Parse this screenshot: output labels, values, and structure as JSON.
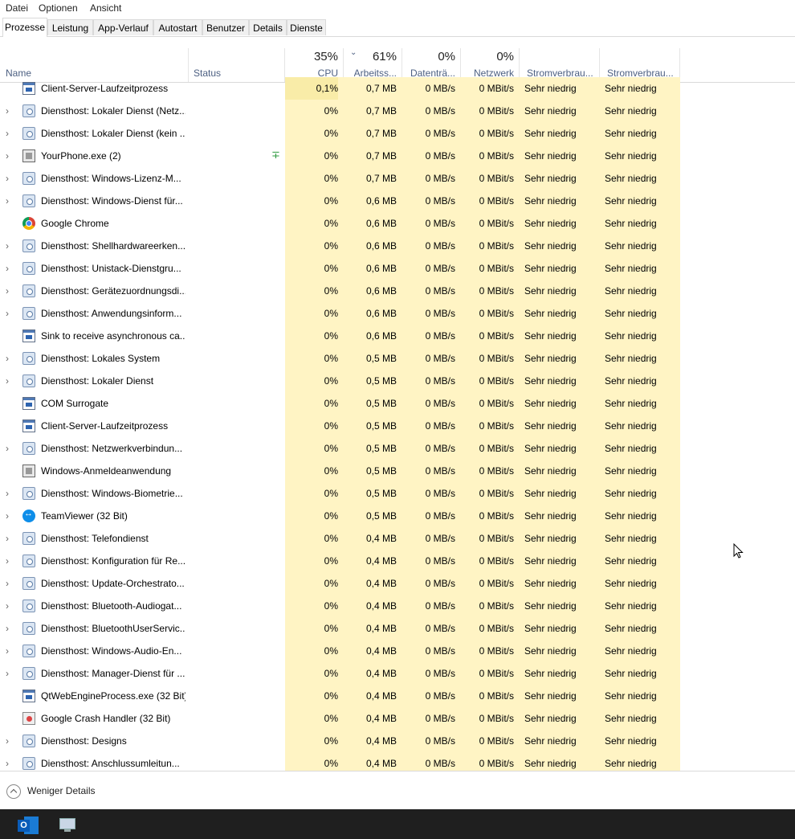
{
  "menu": [
    "Datei",
    "Optionen",
    "Ansicht"
  ],
  "tabs": [
    "Prozesse",
    "Leistung",
    "App-Verlauf",
    "Autostart",
    "Benutzer",
    "Details",
    "Dienste"
  ],
  "active_tab": 0,
  "columns": {
    "name": {
      "label": "Name"
    },
    "status": {
      "label": "Status"
    },
    "cpu": {
      "label": "CPU",
      "pct": "35%"
    },
    "mem": {
      "label": "Arbeitss...",
      "pct": "61%"
    },
    "disk": {
      "label": "Datenträ...",
      "pct": "0%"
    },
    "net": {
      "label": "Netzwerk",
      "pct": "0%"
    },
    "power": {
      "label": "Stromverbrau..."
    },
    "power_trend": {
      "label": "Stromverbrau..."
    }
  },
  "rows": [
    {
      "name": "Client-Server-Laufzeitprozess",
      "icon": "window-icon",
      "expand": false,
      "eco": false,
      "cpu": "0,1%",
      "mem": "0,7 MB",
      "disk": "0 MB/s",
      "net": "0 MBit/s",
      "power": "Sehr niedrig",
      "trend": "Sehr niedrig"
    },
    {
      "name": "Diensthost: Lokaler Dienst (Netz...",
      "icon": "gear-icon",
      "expand": true,
      "eco": false,
      "cpu": "0%",
      "mem": "0,7 MB",
      "disk": "0 MB/s",
      "net": "0 MBit/s",
      "power": "Sehr niedrig",
      "trend": "Sehr niedrig"
    },
    {
      "name": "Diensthost: Lokaler Dienst (kein ...",
      "icon": "gear-icon",
      "expand": true,
      "eco": false,
      "cpu": "0%",
      "mem": "0,7 MB",
      "disk": "0 MB/s",
      "net": "0 MBit/s",
      "power": "Sehr niedrig",
      "trend": "Sehr niedrig"
    },
    {
      "name": "YourPhone.exe (2)",
      "icon": "phone-app-icon",
      "expand": true,
      "eco": true,
      "cpu": "0%",
      "mem": "0,7 MB",
      "disk": "0 MB/s",
      "net": "0 MBit/s",
      "power": "Sehr niedrig",
      "trend": "Sehr niedrig"
    },
    {
      "name": "Diensthost: Windows-Lizenz-M...",
      "icon": "gear-icon",
      "expand": true,
      "eco": false,
      "cpu": "0%",
      "mem": "0,7 MB",
      "disk": "0 MB/s",
      "net": "0 MBit/s",
      "power": "Sehr niedrig",
      "trend": "Sehr niedrig"
    },
    {
      "name": "Diensthost: Windows-Dienst für...",
      "icon": "gear-icon",
      "expand": true,
      "eco": false,
      "cpu": "0%",
      "mem": "0,6 MB",
      "disk": "0 MB/s",
      "net": "0 MBit/s",
      "power": "Sehr niedrig",
      "trend": "Sehr niedrig"
    },
    {
      "name": "Google Chrome",
      "icon": "chrome-icon",
      "expand": false,
      "eco": false,
      "cpu": "0%",
      "mem": "0,6 MB",
      "disk": "0 MB/s",
      "net": "0 MBit/s",
      "power": "Sehr niedrig",
      "trend": "Sehr niedrig"
    },
    {
      "name": "Diensthost: Shellhardwareerken...",
      "icon": "gear-icon",
      "expand": true,
      "eco": false,
      "cpu": "0%",
      "mem": "0,6 MB",
      "disk": "0 MB/s",
      "net": "0 MBit/s",
      "power": "Sehr niedrig",
      "trend": "Sehr niedrig"
    },
    {
      "name": "Diensthost: Unistack-Dienstgru...",
      "icon": "gear-icon",
      "expand": true,
      "eco": false,
      "cpu": "0%",
      "mem": "0,6 MB",
      "disk": "0 MB/s",
      "net": "0 MBit/s",
      "power": "Sehr niedrig",
      "trend": "Sehr niedrig"
    },
    {
      "name": "Diensthost: Gerätezuordnungsdi...",
      "icon": "gear-icon",
      "expand": true,
      "eco": false,
      "cpu": "0%",
      "mem": "0,6 MB",
      "disk": "0 MB/s",
      "net": "0 MBit/s",
      "power": "Sehr niedrig",
      "trend": "Sehr niedrig"
    },
    {
      "name": "Diensthost: Anwendungsinform...",
      "icon": "gear-icon",
      "expand": true,
      "eco": false,
      "cpu": "0%",
      "mem": "0,6 MB",
      "disk": "0 MB/s",
      "net": "0 MBit/s",
      "power": "Sehr niedrig",
      "trend": "Sehr niedrig"
    },
    {
      "name": "Sink to receive asynchronous ca...",
      "icon": "window-icon",
      "expand": false,
      "eco": false,
      "cpu": "0%",
      "mem": "0,6 MB",
      "disk": "0 MB/s",
      "net": "0 MBit/s",
      "power": "Sehr niedrig",
      "trend": "Sehr niedrig"
    },
    {
      "name": "Diensthost: Lokales System",
      "icon": "gear-icon",
      "expand": true,
      "eco": false,
      "cpu": "0%",
      "mem": "0,5 MB",
      "disk": "0 MB/s",
      "net": "0 MBit/s",
      "power": "Sehr niedrig",
      "trend": "Sehr niedrig"
    },
    {
      "name": "Diensthost: Lokaler Dienst",
      "icon": "gear-icon",
      "expand": true,
      "eco": false,
      "cpu": "0%",
      "mem": "0,5 MB",
      "disk": "0 MB/s",
      "net": "0 MBit/s",
      "power": "Sehr niedrig",
      "trend": "Sehr niedrig"
    },
    {
      "name": "COM Surrogate",
      "icon": "window-icon",
      "expand": false,
      "eco": false,
      "cpu": "0%",
      "mem": "0,5 MB",
      "disk": "0 MB/s",
      "net": "0 MBit/s",
      "power": "Sehr niedrig",
      "trend": "Sehr niedrig"
    },
    {
      "name": "Client-Server-Laufzeitprozess",
      "icon": "window-icon",
      "expand": false,
      "eco": false,
      "cpu": "0%",
      "mem": "0,5 MB",
      "disk": "0 MB/s",
      "net": "0 MBit/s",
      "power": "Sehr niedrig",
      "trend": "Sehr niedrig"
    },
    {
      "name": "Diensthost: Netzwerkverbindun...",
      "icon": "gear-icon",
      "expand": true,
      "eco": false,
      "cpu": "0%",
      "mem": "0,5 MB",
      "disk": "0 MB/s",
      "net": "0 MBit/s",
      "power": "Sehr niedrig",
      "trend": "Sehr niedrig"
    },
    {
      "name": "Windows-Anmeldeanwendung",
      "icon": "phone-app-icon",
      "expand": false,
      "eco": false,
      "cpu": "0%",
      "mem": "0,5 MB",
      "disk": "0 MB/s",
      "net": "0 MBit/s",
      "power": "Sehr niedrig",
      "trend": "Sehr niedrig"
    },
    {
      "name": "Diensthost: Windows-Biometrie...",
      "icon": "gear-icon",
      "expand": true,
      "eco": false,
      "cpu": "0%",
      "mem": "0,5 MB",
      "disk": "0 MB/s",
      "net": "0 MBit/s",
      "power": "Sehr niedrig",
      "trend": "Sehr niedrig"
    },
    {
      "name": "TeamViewer (32 Bit)",
      "icon": "teamviewer-icon",
      "expand": true,
      "eco": false,
      "cpu": "0%",
      "mem": "0,5 MB",
      "disk": "0 MB/s",
      "net": "0 MBit/s",
      "power": "Sehr niedrig",
      "trend": "Sehr niedrig"
    },
    {
      "name": "Diensthost: Telefondienst",
      "icon": "gear-icon",
      "expand": true,
      "eco": false,
      "cpu": "0%",
      "mem": "0,4 MB",
      "disk": "0 MB/s",
      "net": "0 MBit/s",
      "power": "Sehr niedrig",
      "trend": "Sehr niedrig"
    },
    {
      "name": "Diensthost: Konfiguration für Re...",
      "icon": "gear-icon",
      "expand": true,
      "eco": false,
      "cpu": "0%",
      "mem": "0,4 MB",
      "disk": "0 MB/s",
      "net": "0 MBit/s",
      "power": "Sehr niedrig",
      "trend": "Sehr niedrig"
    },
    {
      "name": "Diensthost: Update-Orchestrato...",
      "icon": "gear-icon",
      "expand": true,
      "eco": false,
      "cpu": "0%",
      "mem": "0,4 MB",
      "disk": "0 MB/s",
      "net": "0 MBit/s",
      "power": "Sehr niedrig",
      "trend": "Sehr niedrig"
    },
    {
      "name": "Diensthost: Bluetooth-Audiogat...",
      "icon": "gear-icon",
      "expand": true,
      "eco": false,
      "cpu": "0%",
      "mem": "0,4 MB",
      "disk": "0 MB/s",
      "net": "0 MBit/s",
      "power": "Sehr niedrig",
      "trend": "Sehr niedrig"
    },
    {
      "name": "Diensthost: BluetoothUserServic...",
      "icon": "gear-icon",
      "expand": true,
      "eco": false,
      "cpu": "0%",
      "mem": "0,4 MB",
      "disk": "0 MB/s",
      "net": "0 MBit/s",
      "power": "Sehr niedrig",
      "trend": "Sehr niedrig"
    },
    {
      "name": "Diensthost: Windows-Audio-En...",
      "icon": "gear-icon",
      "expand": true,
      "eco": false,
      "cpu": "0%",
      "mem": "0,4 MB",
      "disk": "0 MB/s",
      "net": "0 MBit/s",
      "power": "Sehr niedrig",
      "trend": "Sehr niedrig"
    },
    {
      "name": "Diensthost: Manager-Dienst für ...",
      "icon": "gear-icon",
      "expand": true,
      "eco": false,
      "cpu": "0%",
      "mem": "0,4 MB",
      "disk": "0 MB/s",
      "net": "0 MBit/s",
      "power": "Sehr niedrig",
      "trend": "Sehr niedrig"
    },
    {
      "name": "QtWebEngineProcess.exe (32 Bit)",
      "icon": "window-icon",
      "expand": false,
      "eco": false,
      "cpu": "0%",
      "mem": "0,4 MB",
      "disk": "0 MB/s",
      "net": "0 MBit/s",
      "power": "Sehr niedrig",
      "trend": "Sehr niedrig"
    },
    {
      "name": "Google Crash Handler (32 Bit)",
      "icon": "crash-handler-icon",
      "expand": false,
      "eco": false,
      "cpu": "0%",
      "mem": "0,4 MB",
      "disk": "0 MB/s",
      "net": "0 MBit/s",
      "power": "Sehr niedrig",
      "trend": "Sehr niedrig"
    },
    {
      "name": "Diensthost: Designs",
      "icon": "gear-icon",
      "expand": true,
      "eco": false,
      "cpu": "0%",
      "mem": "0,4 MB",
      "disk": "0 MB/s",
      "net": "0 MBit/s",
      "power": "Sehr niedrig",
      "trend": "Sehr niedrig"
    },
    {
      "name": "Diensthost: Anschlussumleitun...",
      "icon": "gear-icon",
      "expand": true,
      "eco": false,
      "cpu": "0%",
      "mem": "0,4 MB",
      "disk": "0 MB/s",
      "net": "0 MBit/s",
      "power": "Sehr niedrig",
      "trend": "Sehr niedrig"
    }
  ],
  "footer": {
    "fewer_details": "Weniger Details"
  },
  "taskbar": {
    "items": [
      "outlook-icon",
      "monitor-app-icon"
    ],
    "outlook_glyph": "O"
  },
  "colors": {
    "cell_heat": "#fff4c4",
    "cpu_heat_high": "#f9eca8",
    "header_text": "#4d6082",
    "taskbar": "#1f1f1f"
  }
}
